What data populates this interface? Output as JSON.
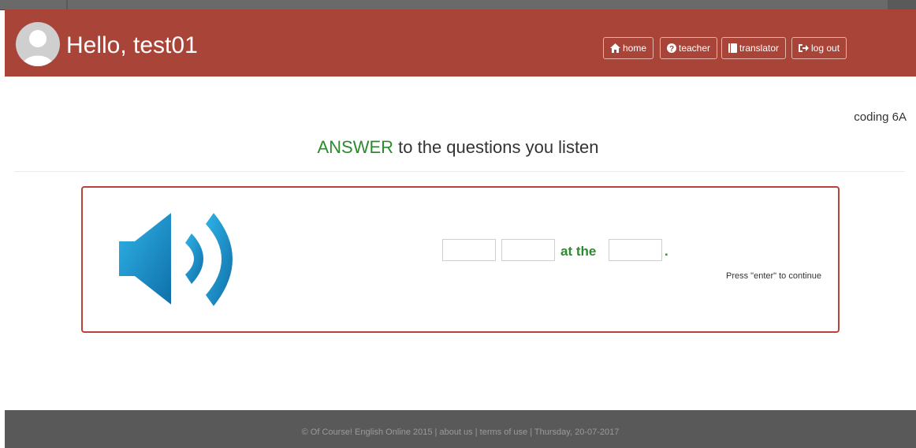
{
  "header": {
    "greeting": "Hello, test01",
    "nav": {
      "home": "home",
      "teacher": "teacher",
      "translator": "translator",
      "logout": "log out"
    }
  },
  "page": {
    "class_label": "coding 6A",
    "heading_highlight": "ANSWER",
    "heading_rest": " to the questions you listen"
  },
  "exercise": {
    "connector": "at the",
    "end_punct": ".",
    "hint": "Press \"enter\" to continue",
    "blanks": [
      "",
      "",
      ""
    ]
  },
  "footer": {
    "text": "© Of Course! English Online 2015 | about us | terms of use | Thursday, 20-07-2017"
  },
  "colors": {
    "header_bg": "#a94438",
    "accent_green": "#2e8a2e",
    "footer_bg": "#595959",
    "speaker_blue": "#1e9ad6"
  }
}
